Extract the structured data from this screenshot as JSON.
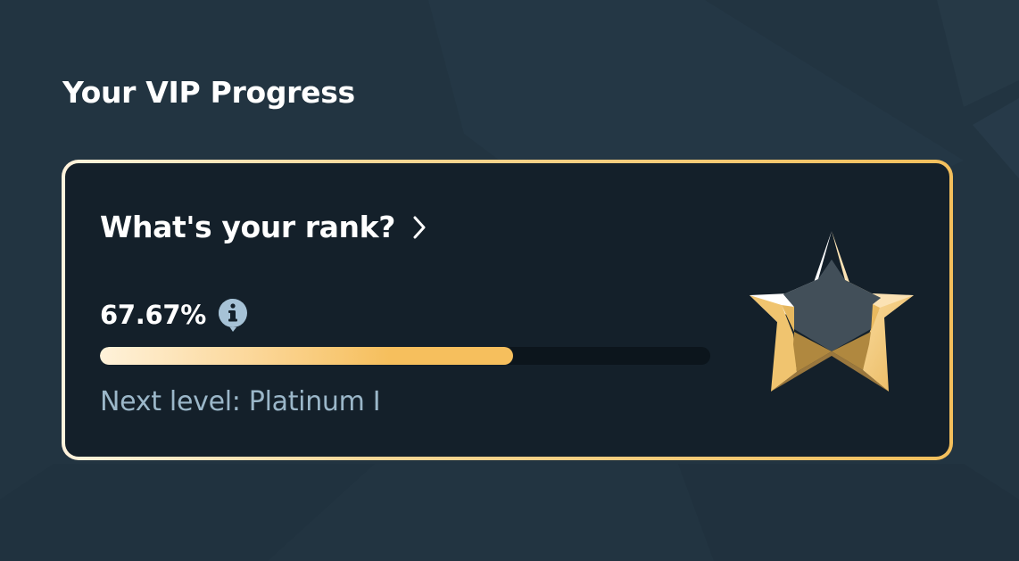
{
  "page": {
    "title": "Your VIP Progress"
  },
  "card": {
    "rank_link_label": "What's your rank?",
    "progress_text": "67.67%",
    "progress_fraction": 0.6767,
    "next_level_text": "Next level: Platinum I"
  },
  "icons": {
    "chevron": "chevron-right-icon",
    "info": "info-icon",
    "rank_badge": "gold-star-badge-icon"
  },
  "colors": {
    "page_background": "#223441",
    "card_background": "#14202a",
    "accent_gold": "#f6bf5d",
    "accent_light": "#fff3dd",
    "muted_text": "#9bb7c9",
    "info_icon": "#a6c2d6"
  }
}
